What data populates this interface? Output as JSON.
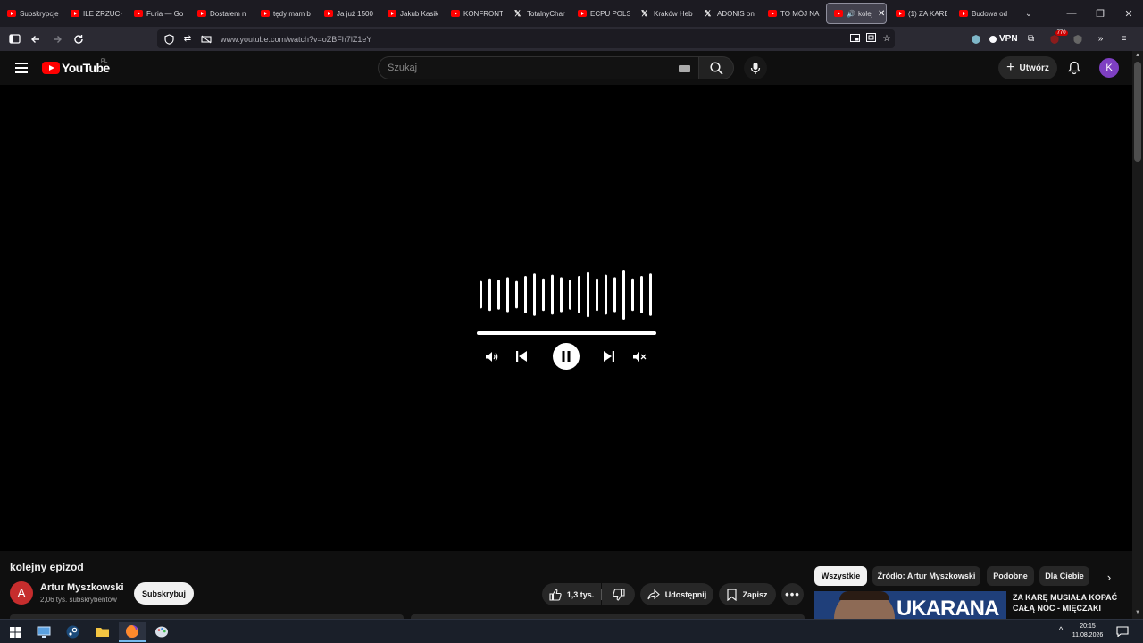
{
  "browser": {
    "tabs": [
      {
        "title": "Subskrypcje",
        "icon": "youtube-icon"
      },
      {
        "title": "ILE ZRZUCIŁ",
        "icon": "youtube-icon"
      },
      {
        "title": "Furia — Go",
        "icon": "youtube-icon"
      },
      {
        "title": "Dostałem n",
        "icon": "youtube-icon"
      },
      {
        "title": "tędy mam b",
        "icon": "youtube-icon"
      },
      {
        "title": "Ja już 1500",
        "icon": "youtube-icon"
      },
      {
        "title": "Jakub Kasik",
        "icon": "youtube-icon"
      },
      {
        "title": "KONFRONT",
        "icon": "youtube-icon"
      },
      {
        "title": "TotalnyChar",
        "icon": "x-icon"
      },
      {
        "title": "ECPU POLSK",
        "icon": "youtube-icon"
      },
      {
        "title": "Kraków Heb",
        "icon": "x-icon"
      },
      {
        "title": "ADONIS on",
        "icon": "x-icon"
      },
      {
        "title": "TO MÓJ NA",
        "icon": "youtube-icon"
      },
      {
        "title": "kolej",
        "icon": "youtube-icon",
        "active": true
      },
      {
        "title": "(1) ZA KARĘ",
        "icon": "youtube-icon"
      },
      {
        "title": "Budowa od",
        "icon": "youtube-icon"
      }
    ],
    "url": "www.youtube.com/watch?v=oZBFh7lZ1eY",
    "vpn_label": "VPN",
    "ext_badge": "770"
  },
  "youtube": {
    "logo_text": "YouTube",
    "region": "PL",
    "search_placeholder": "Szukaj",
    "create_label": "Utwórz",
    "avatar_letter": "K"
  },
  "video": {
    "title": "kolejny epizod",
    "channel": {
      "name": "Artur Myszkowski",
      "avatar_letter": "A",
      "subscribers": "2,06 tys. subskrybentów"
    },
    "subscribe_label": "Subskrybuj",
    "likes": "1,3 tys.",
    "share_label": "Udostępnij",
    "save_label": "Zapisz",
    "waveform_bars": [
      0.55,
      0.65,
      0.6,
      0.7,
      0.55,
      0.75,
      0.85,
      0.65,
      0.8,
      0.7,
      0.6,
      0.75,
      0.9,
      0.65,
      0.8,
      0.7,
      1.0,
      0.65,
      0.75,
      0.85
    ],
    "progress": 1.0
  },
  "chips": [
    "Wszystkie",
    "Źródło: Artur Myszkowski",
    "Podobne",
    "Dla Ciebie"
  ],
  "recommendation": {
    "title": "ZA KARĘ MUSIAŁA KOPAĆ CAŁĄ NOC - MIĘCZAKI",
    "thumb_text": "UKARANA"
  },
  "taskbar": {
    "time": "20:15",
    "date": "11.08.2026"
  },
  "colors": {
    "yt_red": "#ff0000",
    "background": "#0f0f0f",
    "channel_avatar": "#c62d2d",
    "user_avatar": "#7e3fc2"
  }
}
